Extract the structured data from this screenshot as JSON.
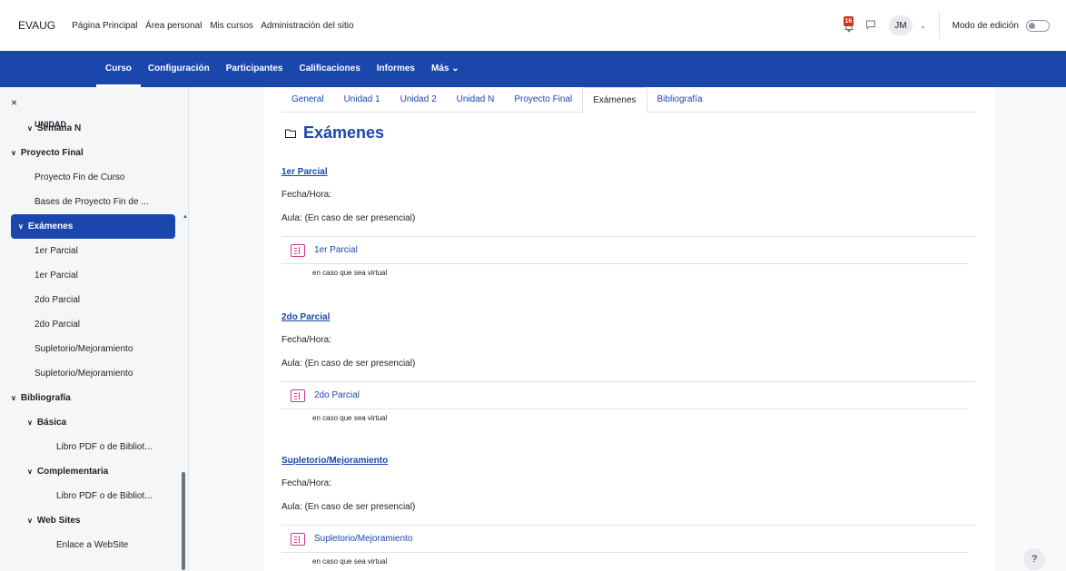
{
  "brand": "EVAUG",
  "topnav": [
    "Página Principal",
    "Área personal",
    "Mis cursos",
    "Administración del sitio"
  ],
  "notifications": {
    "count": "16",
    "icon": "bell-icon"
  },
  "user": {
    "initials": "JM"
  },
  "edit_mode": {
    "label": "Modo de edición",
    "on": false
  },
  "coursebar": [
    "Curso",
    "Configuración",
    "Participantes",
    "Calificaciones",
    "Informes",
    "Más"
  ],
  "coursebar_more_suffix": "⌄",
  "sidebar": {
    "close": "×",
    "partial_top": "UNIDAD",
    "items": [
      {
        "label": "Semana N",
        "level": 1,
        "chevron": true,
        "bold": true
      },
      {
        "label": "Proyecto Final",
        "level": 0,
        "chevron": true,
        "bold": true
      },
      {
        "label": "Proyecto Fin de Curso",
        "level": 1
      },
      {
        "label": "Bases de Proyecto Fin de ...",
        "level": 1
      },
      {
        "label": "Exámenes",
        "level": 0,
        "chevron": true,
        "bold": true,
        "highlight": true
      },
      {
        "label": "1er Parcial",
        "level": 1
      },
      {
        "label": "1er Parcial",
        "level": 1
      },
      {
        "label": "2do Parcial",
        "level": 1
      },
      {
        "label": "2do Parcial",
        "level": 1
      },
      {
        "label": "Supletorio/Mejoramiento",
        "level": 1
      },
      {
        "label": "Supletorio/Mejoramiento",
        "level": 1
      },
      {
        "label": "Bibliografía",
        "level": 0,
        "chevron": true,
        "bold": true
      },
      {
        "label": "Básica",
        "level": 1,
        "chevron": true,
        "bold": true
      },
      {
        "label": "Libro PDF o de Bibliot...",
        "level": 2
      },
      {
        "label": "Complementaria",
        "level": 1,
        "chevron": true,
        "bold": true
      },
      {
        "label": "Libro PDF o de Bibliot...",
        "level": 2
      },
      {
        "label": "Web Sites",
        "level": 1,
        "chevron": true,
        "bold": true
      },
      {
        "label": "Enlace a WebSite",
        "level": 2
      }
    ]
  },
  "tabs": [
    "General",
    "Unidad 1",
    "Unidad 2",
    "Unidad N",
    "Proyecto Final",
    "Exámenes",
    "Bibliografía"
  ],
  "active_tab": "Exámenes",
  "section_title": "Exámenes",
  "blocks": [
    {
      "title": "1er Parcial",
      "date": "Fecha/Hora:",
      "room": "Aula: (En caso de ser presencial)",
      "activity": "1er Parcial",
      "desc": "en caso que sea virtual"
    },
    {
      "title": "2do Parcial",
      "date": "Fecha/Hora:",
      "room": "Aula: (En caso de ser presencial)",
      "activity": "2do Parcial",
      "desc": "en caso que sea virtual"
    },
    {
      "title": "Supletorio/Mejoramiento",
      "date": "Fecha/Hora:",
      "room": "Aula: (En caso de ser presencial)",
      "activity": "Supletorio/Mejoramiento",
      "desc": "en caso que sea virtual"
    }
  ],
  "help": "?",
  "colors": {
    "primary": "#1b47ad",
    "activity_icon": "#d63384",
    "badge": "#ca3120"
  }
}
